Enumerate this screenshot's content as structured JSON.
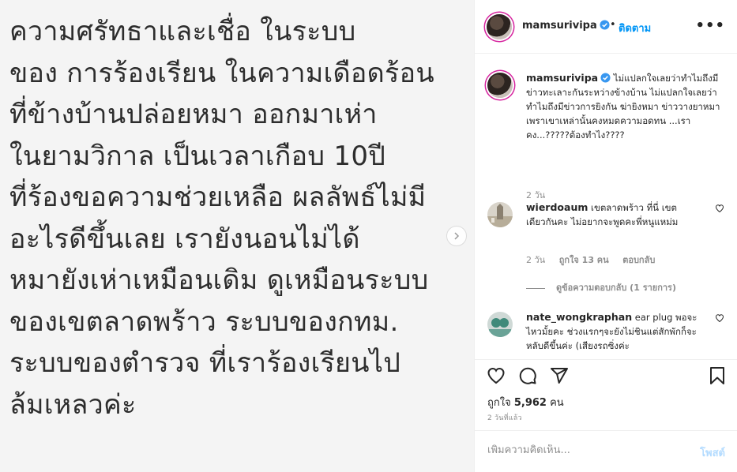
{
  "post": {
    "image_lines": [
      "ความศรัทธาและเชื่อ ในระบบ",
      "ของ การร้องเรียน  ในความเดือดร้อน",
      "ที่ข้างบ้านปล่อยหมา ออกมาเห่า",
      "ในยามวิกาล เป็นเวลาเกือบ 10ปี",
      "ที่ร้องขอความช่วยเหลือ ผลลัพธ์ไม่มี",
      "อะไรดีขึ้นเลย เรายังนอนไม่ได้",
      "หมายังเห่าเหมือนเดิม ดูเหมือนระบบ",
      "ของเขตลาดพร้าว ระบบของกทม.",
      "ระบบของตำรวจ ที่เราร้องเรียนไป",
      "ล้มเหลวค่ะ"
    ]
  },
  "header": {
    "username": "mamsurivipa",
    "separator": "•",
    "follow_label": "ติดตาม",
    "more_label": "•••"
  },
  "caption": {
    "username": "mamsurivipa",
    "text": "ไม่แปลกใจเลยว่าทำไมถึงมีข่าวทะเลาะกันระหว่างข้างบ้าน ไม่แปลกใจเลยว่า ทำไมถึงมีข่าวการยิงกัน ฆ่ายิงหมา ข่าววางยาหมา เพราเขาเหล่านั้นคงหมดความอดทน ...เราคง...?????ต้องทำไง????",
    "time": "2 วัน"
  },
  "comments": [
    {
      "username": "wierdoaum",
      "text": "เขตลาดพร้าว ที่นี่ เขต เดียวกันคะ ไม่อยากจะพูดคะพี่หนูแหม่ม",
      "time": "2 วัน",
      "likes": "ถูกใจ 13 คน",
      "reply_label": "ตอบกลับ",
      "view_replies": "ดูข้อความตอบกลับ (1 รายการ)"
    },
    {
      "username": "nate_wongkraphan",
      "text": "ear plug พอจะไหวมั้ยคะ ช่วงแรกๆจะยังไม่ชินแต่สักพักก็จะหลับดีขึ้นค่ะ (เสียงรถซิ่งค่ะ"
    }
  ],
  "actions": {
    "likes_prefix": "ถูกใจ ",
    "likes_count": "5,962",
    "likes_suffix": " คน",
    "timestamp": "2 วันที่แล้ว"
  },
  "add_comment": {
    "placeholder": "เพิ่มความคิดเห็น...",
    "post_label": "โพสต์"
  },
  "colors": {
    "accent": "#0095f6",
    "post_disabled": "#b3dbff",
    "muted": "#8e8e8e"
  }
}
